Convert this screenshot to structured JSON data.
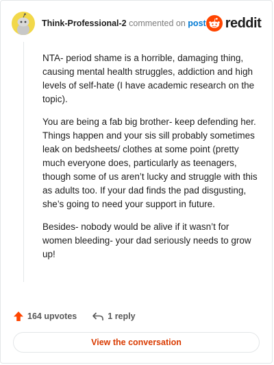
{
  "comment": {
    "username": "Think-Professional-2",
    "action_text": "commented on",
    "post_link": "post",
    "paragraphs": [
      "NTA- period shame is a horrible, damaging thing, causing mental health struggles, addiction and high levels of self-hate (I have academic research on the topic).",
      "You are being a fab big brother- keep defending her. Things happen and your sis sill probably sometimes leak on bedsheets/ clothes at some point (pretty much everyone does, particularly as teenagers, though some of us aren’t lucky and struggle with this as adults too. If your dad finds the pad disgusting, she’s going to need your support in future.",
      "Besides- nobody would be alive if it wasn’t for women bleeding- your dad seriously needs to grow up!"
    ],
    "upvotes": "164 upvotes",
    "replies": "1 reply",
    "cta": "View the conversation"
  },
  "brand": {
    "name": "reddit",
    "icon": "reddit-snoo-icon",
    "color": "#ff4500"
  },
  "icons": {
    "upvote": "upvote-arrow-icon",
    "reply": "reply-arrow-icon",
    "avatar": "snoo-avatar-icon"
  },
  "colors": {
    "link": "#0079d3",
    "upvote": "#ff4500",
    "cta_text": "#d93a00",
    "avatar_bg": "#f2d84a"
  }
}
